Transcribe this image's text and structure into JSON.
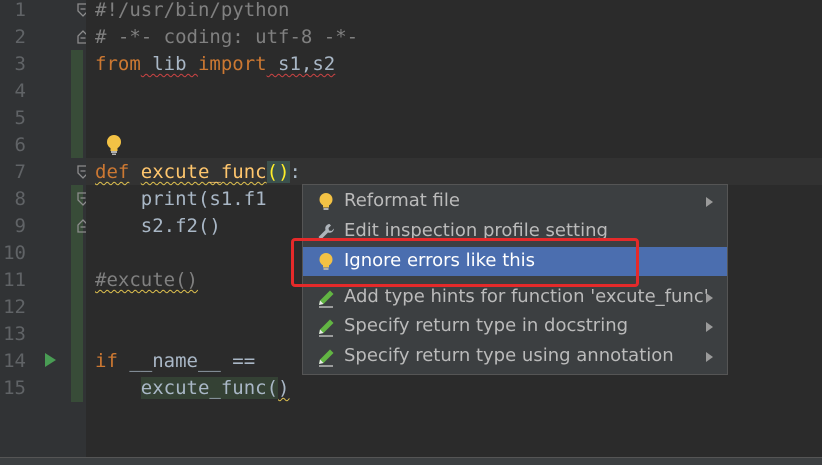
{
  "line_numbers": [
    "1",
    "2",
    "3",
    "4",
    "5",
    "6",
    "7",
    "8",
    "9",
    "10",
    "11",
    "12",
    "13",
    "14",
    "15"
  ],
  "code": {
    "line1": "#!/usr/bin/python",
    "line2": "# -*- coding: utf-8 -*-",
    "line3": {
      "kw_from": "from",
      "module": " lib ",
      "kw_import": "import",
      "names": " s1,s2"
    },
    "line7": {
      "kw_def": "def",
      "func_name": "excute_func",
      "parens": "()",
      "colon": ":"
    },
    "line8": "    print(s1.f1",
    "line9": "    s2.f2()",
    "line11": "#excute()",
    "line14": {
      "kw_if": "if",
      "rest": " __name__ =="
    },
    "line15": {
      "indent": "    ",
      "call": "excute_func(",
      "close": ")"
    }
  },
  "context_menu": {
    "items": [
      {
        "label": "Reformat file",
        "icon": "lightbulb-icon",
        "has_submenu": true
      },
      {
        "label": "Edit inspection profile setting",
        "icon": "wrench-icon",
        "has_submenu": false
      },
      {
        "label": "Ignore errors like this",
        "icon": "lightbulb-icon",
        "has_submenu": false,
        "selected": true
      },
      {
        "label": "Add type hints for function 'excute_func'",
        "icon": "pencil-icon",
        "has_submenu": true
      },
      {
        "label": "Specify return type in docstring",
        "icon": "pencil-icon",
        "has_submenu": true
      },
      {
        "label": "Specify return type using annotation",
        "icon": "pencil-icon",
        "has_submenu": true
      }
    ]
  },
  "colors": {
    "editor_bg": "#2b2b2b",
    "gutter_bg": "#313335",
    "keyword": "#cc7832",
    "function": "#ffc66d",
    "comment": "#808080",
    "selection": "#4b6eaf",
    "annotation_box": "#e52a2a"
  }
}
